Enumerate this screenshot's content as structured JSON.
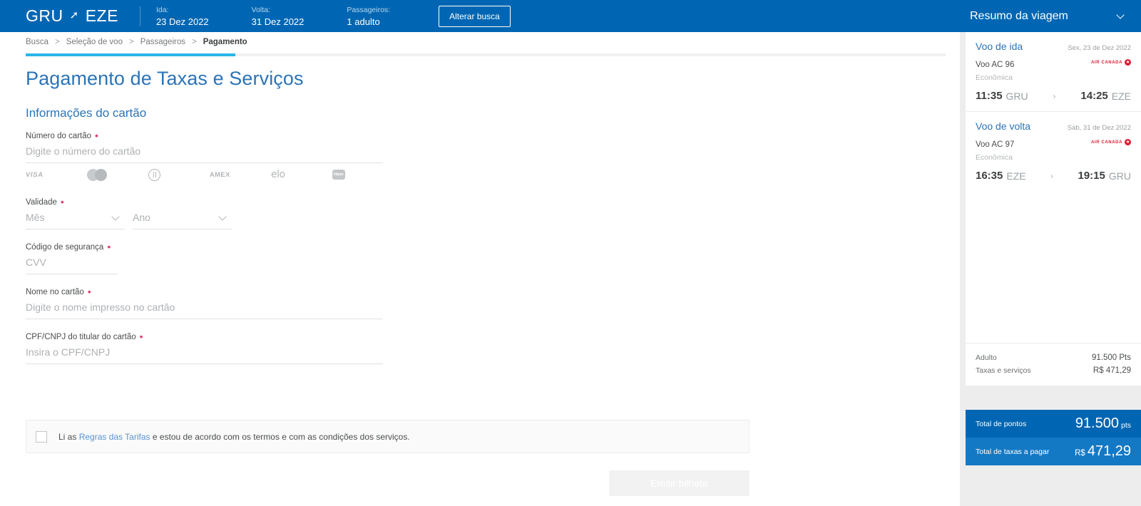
{
  "topbar": {
    "origin": "GRU",
    "plane_icon": "plane-icon",
    "destination": "EZE",
    "outbound": {
      "label": "Ida:",
      "value": "23 Dez 2022"
    },
    "inbound": {
      "label": "Volta:",
      "value": "31 Dez 2022"
    },
    "passengers": {
      "label": "Passageiros:",
      "value": "1 adulto"
    },
    "change_search_label": "Alterar busca",
    "summary_title": "Resumo da viagem"
  },
  "breadcrumb": {
    "items": [
      "Busca",
      "Seleção de voo",
      "Passageiros",
      "Pagamento"
    ],
    "separator": ">",
    "active_index": 3,
    "progress_percent": 23
  },
  "page": {
    "title": "Pagamento de Taxas e Serviços",
    "section_title": "Informações do cartão"
  },
  "form": {
    "card_number": {
      "label": "Número do cartão",
      "required_marker": "•",
      "placeholder": "Digite o número do cartão",
      "value": ""
    },
    "card_brands": [
      {
        "name": "VISA",
        "icon": "visa-logo"
      },
      {
        "name": "Mastercard",
        "icon": "mastercard-logo"
      },
      {
        "name": "Diners Club",
        "icon": "diners-logo"
      },
      {
        "name": "AMEX",
        "icon": "amex-logo"
      },
      {
        "name": "elo",
        "icon": "elo-logo"
      },
      {
        "name": "Hiper",
        "icon": "hiper-logo"
      }
    ],
    "validity": {
      "label": "Validade",
      "required_marker": "•",
      "month_placeholder": "Mês",
      "month_value": "",
      "year_placeholder": "Ano",
      "year_value": ""
    },
    "security_code": {
      "label": "Código de segurança",
      "required_marker": "•",
      "placeholder": "CVV",
      "value": ""
    },
    "card_name": {
      "label": "Nome no cartão",
      "required_marker": "•",
      "placeholder": "Digite o nome impresso no cartão",
      "value": ""
    },
    "document": {
      "label": "CPF/CNPJ do titular do cartão",
      "required_marker": "•",
      "placeholder": "Insira o CPF/CNPJ",
      "value": ""
    }
  },
  "terms": {
    "checked": false,
    "text_before": "Li as ",
    "link_text": "Regras das Tarifas",
    "text_after": " e estou de acordo com os termos e com as condições dos serviços."
  },
  "submit": {
    "label": "Emitir bilhete",
    "disabled": true
  },
  "sidebar": {
    "flights": [
      {
        "title": "Voo de ida",
        "date": "Sex, 23 de Dez 2022",
        "flight_number": "Voo AC 96",
        "cabin": "Econômica",
        "airline": "AIR CANADA",
        "airline_icon": "maple-leaf-icon",
        "depart_time": "11:35",
        "depart_airport": "GRU",
        "arrow": "›",
        "arrive_time": "14:25",
        "arrive_airport": "EZE"
      },
      {
        "title": "Voo de volta",
        "date": "Sáb, 31 de Dez 2022",
        "flight_number": "Voo AC 97",
        "cabin": "Econômica",
        "airline": "AIR CANADA",
        "airline_icon": "maple-leaf-icon",
        "depart_time": "16:35",
        "depart_airport": "EZE",
        "arrow": "›",
        "arrive_time": "19:15",
        "arrive_airport": "GRU"
      }
    ],
    "breakdown": [
      {
        "label": "Adulto",
        "value": "91.500 Pts"
      },
      {
        "label": "Taxas e serviços",
        "value": "R$ 471,29"
      }
    ],
    "total_points": {
      "label": "Total de pontos",
      "amount": "91.500",
      "unit": "pts"
    },
    "total_cash": {
      "label": "Total de taxas a pagar",
      "currency": "R$",
      "amount": "471,29"
    }
  },
  "colors": {
    "brand_blue": "#0066b3",
    "link_blue": "#2b74b8",
    "progress_cyan": "#2ab6e8",
    "required_red": "#d6436a",
    "airline_red": "#e01933",
    "total_cash_blue": "#1479c4"
  }
}
